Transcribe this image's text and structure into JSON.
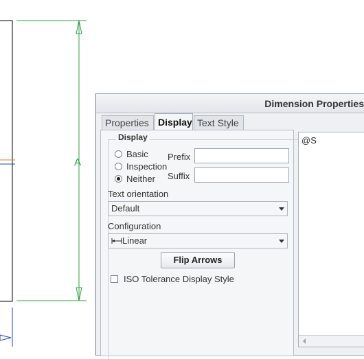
{
  "dialog": {
    "title": "Dimension Properties",
    "tabs": [
      {
        "label": "Properties",
        "active": false
      },
      {
        "label": "Display",
        "active": true
      },
      {
        "label": "Text Style",
        "active": false
      }
    ],
    "display_group": {
      "label": "Display",
      "radios": [
        {
          "label": "Basic",
          "selected": false
        },
        {
          "label": "Inspection",
          "selected": false
        },
        {
          "label": "Neither",
          "selected": true
        }
      ],
      "prefix_label": "Prefix",
      "prefix_value": "",
      "suffix_label": "Suffix",
      "suffix_value": ""
    },
    "text_orientation": {
      "label": "Text orientation",
      "selected": "Default"
    },
    "configuration": {
      "label": "Configuration",
      "selected": "Linear"
    },
    "flip_arrows_label": "Flip Arrows",
    "iso_tolerance": {
      "label": "ISO Tolerance Display Style",
      "checked": false
    },
    "dimension_text": "@S"
  },
  "drawing": {
    "dimension_label": "A",
    "colors": {
      "dimension": "#2ea043",
      "part_edge": "#000000",
      "accent_blue": "#1f3fbf",
      "orange": "#e07a2d"
    }
  }
}
